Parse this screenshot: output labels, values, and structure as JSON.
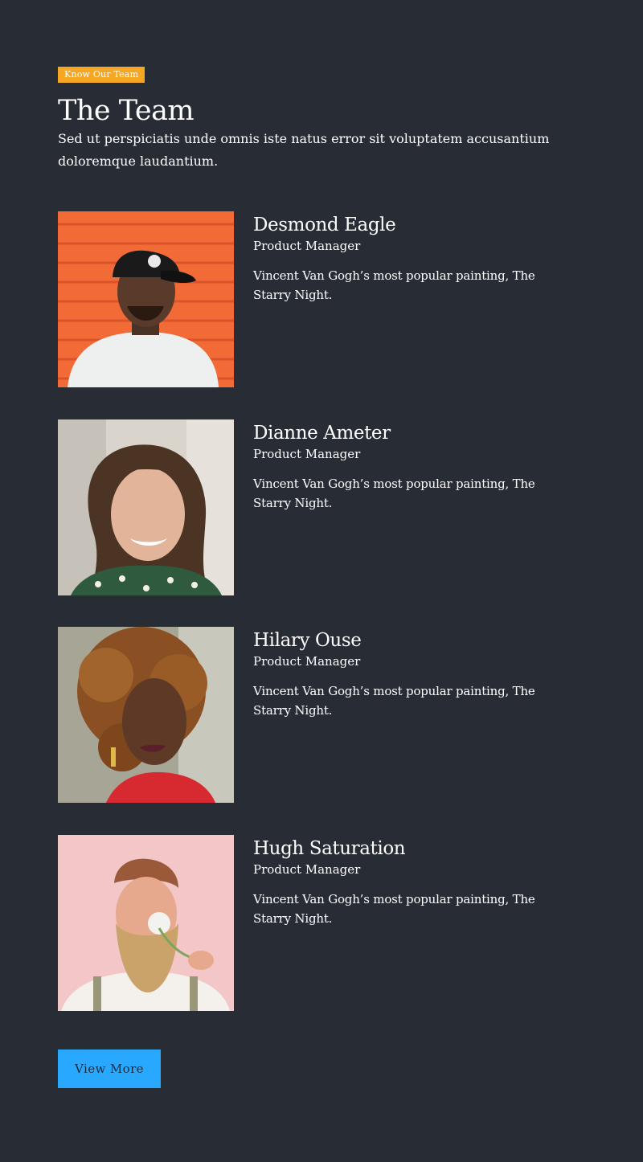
{
  "header": {
    "badge": "Know Our Team",
    "title": "The Team",
    "intro": "Sed ut perspiciatis unde omnis iste natus error sit voluptatem accusantium doloremque laudantium."
  },
  "members": [
    {
      "name": "Desmond Eagle",
      "role": "Product Manager",
      "bio": "Vincent Van Gogh’s most popular painting, The Starry Night."
    },
    {
      "name": "Dianne Ameter",
      "role": "Product Manager",
      "bio": "Vincent Van Gogh’s most popular painting, The Starry Night."
    },
    {
      "name": "Hilary Ouse",
      "role": "Product Manager",
      "bio": "Vincent Van Gogh’s most popular painting, The Starry Night."
    },
    {
      "name": "Hugh Saturation",
      "role": "Product Manager",
      "bio": "Vincent Van Gogh’s most popular painting, The Starry Night."
    }
  ],
  "cta": {
    "label": "View More"
  },
  "colors": {
    "background": "#272c35",
    "badge": "#f5a623",
    "button": "#29a8ff",
    "text": "#ffffff"
  }
}
